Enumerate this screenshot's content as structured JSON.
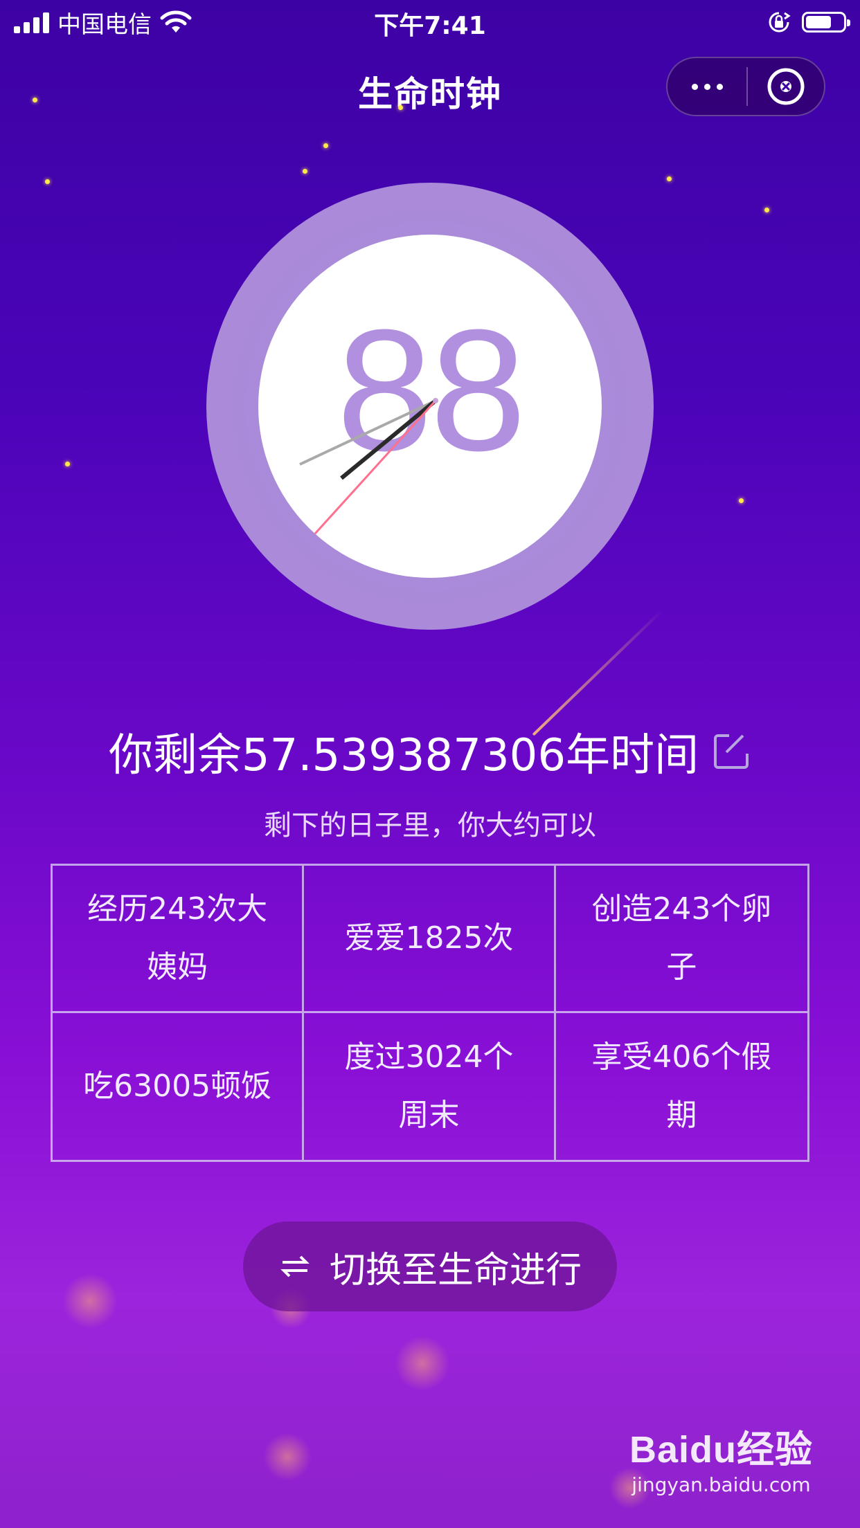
{
  "status_bar": {
    "carrier": "中国电信",
    "time": "下午7:41"
  },
  "nav": {
    "title": "生命时钟"
  },
  "clock": {
    "age": "88"
  },
  "remaining": {
    "text": "你剩余57.539387306年时间",
    "subtitle": "剩下的日子里，你大约可以"
  },
  "stats": [
    {
      "text": "经历243次大姨妈"
    },
    {
      "text": "爱爱1825次"
    },
    {
      "text": "创造243个卵子"
    },
    {
      "text": "吃63005顿饭"
    },
    {
      "text": "度过3024个周末"
    },
    {
      "text": "享受406个假期"
    }
  ],
  "switch_button": {
    "label": "切换至生命进行"
  },
  "watermark": {
    "logo": "Baidu经验",
    "url": "jingyan.baidu.com"
  },
  "colors": {
    "background_top": "#3d02a4",
    "background_bottom": "#9c24dc",
    "clock_ring": "#a98ad9",
    "clock_number": "#b290e0",
    "star": "#ffe94a"
  }
}
